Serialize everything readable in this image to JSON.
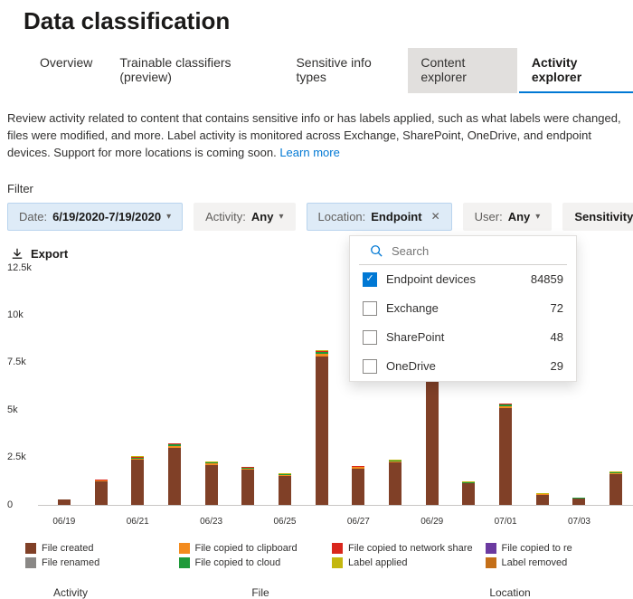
{
  "title": "Data classification",
  "tabs": [
    {
      "label": "Overview",
      "state": "normal"
    },
    {
      "label": "Trainable classifiers (preview)",
      "state": "normal"
    },
    {
      "label": "Sensitive info types",
      "state": "normal"
    },
    {
      "label": "Content explorer",
      "state": "selected-bg"
    },
    {
      "label": "Activity explorer",
      "state": "active"
    }
  ],
  "description": "Review activity related to content that contains sensitive info or has labels applied, such as what labels were changed, files were modified, and more. Label activity is monitored across Exchange, SharePoint, OneDrive, and endpoint devices. Support for more locations is coming soon.",
  "learn_more": "Learn more",
  "filter_label": "Filter",
  "pills": {
    "date": {
      "key": "Date:",
      "value": "6/19/2020-7/19/2020"
    },
    "activity": {
      "key": "Activity:",
      "value": "Any"
    },
    "location": {
      "key": "Location:",
      "value": "Endpoint"
    },
    "user": {
      "key": "User:",
      "value": "Any"
    },
    "sensitivity": {
      "key": "",
      "value": "Sensitivity"
    }
  },
  "dropdown": {
    "search_placeholder": "Search",
    "items": [
      {
        "name": "Endpoint devices",
        "count": "84859",
        "checked": true
      },
      {
        "name": "Exchange",
        "count": "72",
        "checked": false
      },
      {
        "name": "SharePoint",
        "count": "48",
        "checked": false
      },
      {
        "name": "OneDrive",
        "count": "29",
        "checked": false
      }
    ]
  },
  "export_label": "Export",
  "chart_data": {
    "type": "bar",
    "ylabel": "",
    "ylim": [
      0,
      12500
    ],
    "yticks": [
      "12.5k",
      "10k",
      "7.5k",
      "5k",
      "2.5k",
      "0"
    ],
    "categories": [
      "06/19",
      "",
      "06/21",
      "",
      "06/23",
      "",
      "06/25",
      "",
      "06/27",
      "",
      "06/29",
      "",
      "07/01",
      "",
      "07/03",
      ""
    ],
    "series": [
      {
        "name": "File created",
        "class": "c-filecreated",
        "values": [
          250,
          1200,
          2350,
          3000,
          2100,
          1850,
          1500,
          7800,
          1900,
          2200,
          8000,
          1100,
          5100,
          500,
          300,
          1600
        ]
      },
      {
        "name": "File copied to clipboard",
        "class": "c-clipboard",
        "values": [
          0,
          50,
          80,
          100,
          60,
          60,
          50,
          150,
          60,
          70,
          160,
          40,
          100,
          30,
          20,
          50
        ]
      },
      {
        "name": "File copied to cloud",
        "class": "c-cloud",
        "values": [
          0,
          30,
          50,
          60,
          40,
          40,
          30,
          80,
          40,
          40,
          90,
          30,
          60,
          20,
          20,
          30
        ]
      },
      {
        "name": "File copied to network share",
        "class": "c-networkshare",
        "values": [
          0,
          30,
          40,
          50,
          30,
          30,
          30,
          70,
          30,
          30,
          80,
          20,
          50,
          20,
          20,
          30
        ]
      },
      {
        "name": "Label applied",
        "class": "c-labelapplied",
        "values": [
          0,
          20,
          30,
          30,
          20,
          20,
          20,
          50,
          20,
          20,
          50,
          20,
          30,
          10,
          10,
          20
        ]
      },
      {
        "name": "File copied to removable media",
        "class": "c-removable",
        "values": [
          0,
          0,
          0,
          0,
          0,
          0,
          0,
          0,
          0,
          0,
          0,
          0,
          0,
          0,
          0,
          0
        ]
      },
      {
        "name": "File renamed",
        "class": "c-renamed",
        "values": [
          0,
          0,
          0,
          0,
          0,
          0,
          0,
          0,
          0,
          0,
          0,
          0,
          0,
          0,
          0,
          0
        ]
      },
      {
        "name": "Label removed",
        "class": "c-labelremoved",
        "values": [
          0,
          0,
          0,
          0,
          0,
          0,
          0,
          0,
          0,
          0,
          0,
          0,
          0,
          0,
          0,
          0
        ]
      }
    ]
  },
  "legend": [
    {
      "class": "c-filecreated",
      "label": "File created"
    },
    {
      "class": "c-clipboard",
      "label": "File copied to clipboard"
    },
    {
      "class": "c-networkshare",
      "label": "File copied to network share"
    },
    {
      "class": "c-removable",
      "label": "File copied to re"
    },
    {
      "class": "c-renamed",
      "label": "File renamed"
    },
    {
      "class": "c-cloud",
      "label": "File copied to cloud"
    },
    {
      "class": "c-labelapplied",
      "label": "Label applied"
    },
    {
      "class": "c-labelremoved",
      "label": "Label removed"
    }
  ],
  "footer_axes": [
    "Activity",
    "File",
    "Location"
  ]
}
